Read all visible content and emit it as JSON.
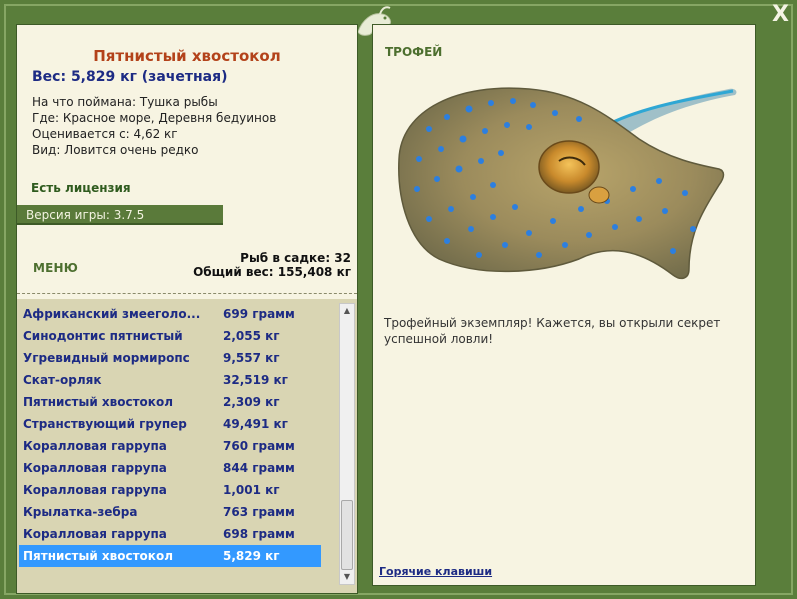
{
  "window": {
    "close_label": "X"
  },
  "fish": {
    "title": "Пятнистый хвостокол",
    "weight_line": "Вес: 5,829 кг (зачетная)",
    "caught_on": "На что поймана: Тушка рыбы",
    "location": "Где: Красное море, Деревня бедуинов",
    "value": "Оценивается с: 4,62 кг",
    "rarity": "Вид: Ловится очень редко"
  },
  "license": "Есть лицензия",
  "version": "Версия игры: 3.7.5",
  "menu_label": "МЕНЮ",
  "stats": {
    "fish_in_cage": "Рыб в садке: 32",
    "total_weight": "Общий вес: 155,408 кг"
  },
  "catch_list": [
    {
      "name": "Африканский змееголо...",
      "weight": "699 грамм"
    },
    {
      "name": "Синодонтис пятнистый",
      "weight": "2,055 кг"
    },
    {
      "name": "Угревидный мормиропс",
      "weight": "9,557 кг"
    },
    {
      "name": "Скат-орляк",
      "weight": "32,519 кг"
    },
    {
      "name": "Пятнистый хвостокол",
      "weight": "2,309 кг"
    },
    {
      "name": "Странствующий групер",
      "weight": "49,491 кг"
    },
    {
      "name": "Коралловая гаррупа",
      "weight": "760 грамм"
    },
    {
      "name": "Коралловая гаррупа",
      "weight": "844 грамм"
    },
    {
      "name": "Коралловая гаррупа",
      "weight": "1,001 кг"
    },
    {
      "name": "Крылатка-зебра",
      "weight": "763 грамм"
    },
    {
      "name": "Коралловая гаррупа",
      "weight": "698 грамм"
    },
    {
      "name": "Пятнистый хвостокол",
      "weight": "5,829 кг",
      "selected": true
    }
  ],
  "trophy": {
    "label": "ТРОФЕЙ",
    "text": "Трофейный экземпляр! Кажется, вы открыли секрет успешной ловли!"
  },
  "hotkeys_label": "Горячие клавиши",
  "colors": {
    "frame_green": "#5a7e3b",
    "panel_bg": "#f7f4e2",
    "list_bg": "#d9d5b3",
    "title_orange": "#b3421a",
    "link_blue": "#1d2b84",
    "selection_blue": "#3399ff"
  }
}
